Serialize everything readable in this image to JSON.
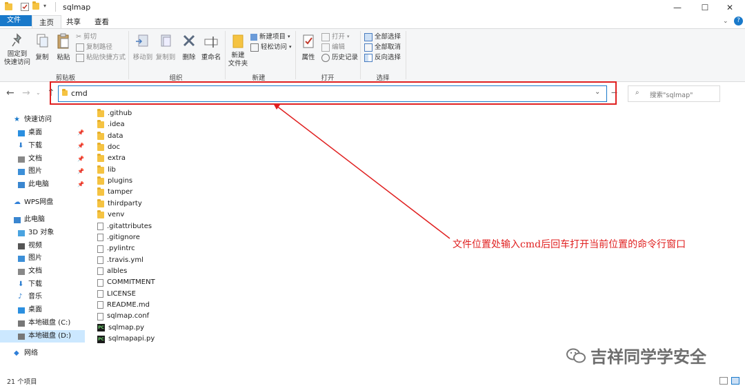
{
  "window": {
    "title": "sqlmap",
    "minimize": "—",
    "maximize": "☐",
    "close": "✕"
  },
  "ribbon_tabs": [
    "文件",
    "主页",
    "共享",
    "查看"
  ],
  "ribbon": {
    "clipboard": {
      "pin_quick_access": "固定到\n快速访问",
      "copy": "复制",
      "paste": "粘贴",
      "cut": "剪切",
      "copy_path": "复制路径",
      "paste_shortcut": "粘贴快捷方式",
      "group": "剪贴板"
    },
    "organize": {
      "move_to": "移动到",
      "copy_to": "复制到",
      "delete": "删除",
      "rename": "重命名",
      "group": "组织"
    },
    "new": {
      "new_folder": "新建\n文件夹",
      "new_item": "新建项目",
      "easy_access": "轻松访问",
      "group": "新建"
    },
    "open": {
      "properties": "属性",
      "open": "打开",
      "edit": "编辑",
      "history": "历史记录",
      "group": "打开"
    },
    "select": {
      "select_all": "全部选择",
      "select_none": "全部取消",
      "invert": "反向选择",
      "group": "选择"
    }
  },
  "address": {
    "value": "cmd",
    "search_placeholder": "搜索\"sqlmap\""
  },
  "nav_pane": [
    {
      "label": "快速访问",
      "icon": "star-icon",
      "indent": 0,
      "pinned": false
    },
    {
      "label": "桌面",
      "icon": "desktop-icon",
      "indent": 1,
      "pinned": true
    },
    {
      "label": "下载",
      "icon": "download-icon",
      "indent": 1,
      "pinned": true
    },
    {
      "label": "文档",
      "icon": "document-icon",
      "indent": 1,
      "pinned": true
    },
    {
      "label": "图片",
      "icon": "picture-icon",
      "indent": 1,
      "pinned": true
    },
    {
      "label": "此电脑",
      "icon": "computer-icon",
      "indent": 1,
      "pinned": true
    },
    {
      "label": "WPS网盘",
      "icon": "cloud-icon",
      "indent": 0,
      "pinned": false
    },
    {
      "label": "此电脑",
      "icon": "computer-icon",
      "indent": 0,
      "pinned": false
    },
    {
      "label": "3D 对象",
      "icon": "cube-icon",
      "indent": 1,
      "pinned": false
    },
    {
      "label": "视频",
      "icon": "video-icon",
      "indent": 1,
      "pinned": false
    },
    {
      "label": "图片",
      "icon": "picture-icon",
      "indent": 1,
      "pinned": false
    },
    {
      "label": "文档",
      "icon": "document-icon",
      "indent": 1,
      "pinned": false
    },
    {
      "label": "下载",
      "icon": "download-icon",
      "indent": 1,
      "pinned": false
    },
    {
      "label": "音乐",
      "icon": "music-icon",
      "indent": 1,
      "pinned": false
    },
    {
      "label": "桌面",
      "icon": "desktop-icon",
      "indent": 1,
      "pinned": false
    },
    {
      "label": "本地磁盘 (C:)",
      "icon": "drive-icon",
      "indent": 1,
      "pinned": false
    },
    {
      "label": "本地磁盘 (D:)",
      "icon": "drive-icon",
      "indent": 1,
      "pinned": false,
      "selected": true
    },
    {
      "label": "网络",
      "icon": "network-icon",
      "indent": 0,
      "pinned": false
    }
  ],
  "files": [
    {
      "name": ".github",
      "type": "folder"
    },
    {
      "name": ".idea",
      "type": "folder"
    },
    {
      "name": "data",
      "type": "folder"
    },
    {
      "name": "doc",
      "type": "folder"
    },
    {
      "name": "extra",
      "type": "folder"
    },
    {
      "name": "lib",
      "type": "folder"
    },
    {
      "name": "plugins",
      "type": "folder"
    },
    {
      "name": "tamper",
      "type": "folder"
    },
    {
      "name": "thirdparty",
      "type": "folder"
    },
    {
      "name": "venv",
      "type": "folder"
    },
    {
      "name": ".gitattributes",
      "type": "file"
    },
    {
      "name": ".gitignore",
      "type": "file"
    },
    {
      "name": ".pylintrc",
      "type": "file"
    },
    {
      "name": ".travis.yml",
      "type": "file"
    },
    {
      "name": "albles",
      "type": "file"
    },
    {
      "name": "COMMITMENT",
      "type": "file"
    },
    {
      "name": "LICENSE",
      "type": "file"
    },
    {
      "name": "README.md",
      "type": "file"
    },
    {
      "name": "sqlmap.conf",
      "type": "file"
    },
    {
      "name": "sqlmap.py",
      "type": "python"
    },
    {
      "name": "sqlmapapi.py",
      "type": "python"
    }
  ],
  "status": {
    "count": "21 个项目"
  },
  "annotation": "文件位置处输入cmd后回车打开当前位置的命令行窗口",
  "watermark": "吉祥同学学安全",
  "colors": {
    "accent": "#1979ca",
    "annotation": "#e02020"
  }
}
